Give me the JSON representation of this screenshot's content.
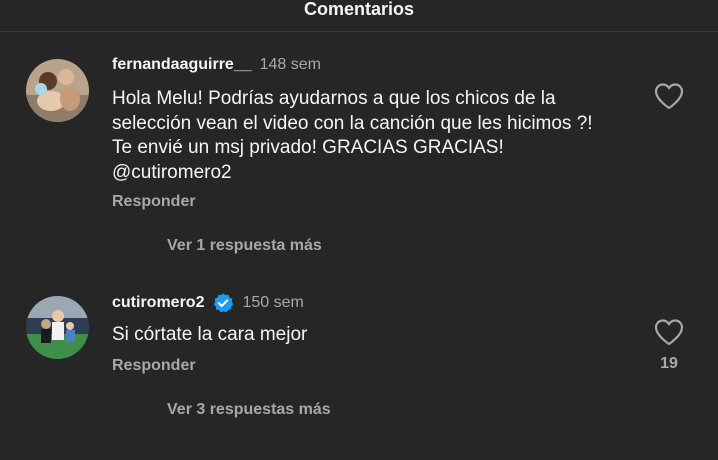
{
  "header": {
    "title": "Comentarios"
  },
  "comments": [
    {
      "username": "fernandaaguirre__",
      "time": "148 sem",
      "text_lines": [
        "Hola Melu! Podrías ayudarnos a que los chicos de la",
        "selección vean el video con la canción que les hicimos ?!",
        "Te envié un msj privado! GRACIAS GRACIAS!",
        "@cutiromero2"
      ],
      "reply_label": "Responder",
      "view_replies": "Ver 1 respuesta más",
      "icons": {
        "avatar": "avatar-image",
        "like": "heart-outline-icon"
      }
    },
    {
      "username": "cutiromero2",
      "time": "150 sem",
      "verified": true,
      "text_lines": [
        "Si córtate la cara mejor"
      ],
      "reply_label": "Responder",
      "view_replies": "Ver 3 respuestas más",
      "like_count": "19",
      "icons": {
        "avatar": "avatar-image",
        "like": "heart-outline-icon",
        "verified": "verified-badge-icon"
      }
    }
  ],
  "colors": {
    "background": "#262626",
    "primary_text": "#f5f5f5",
    "secondary_text": "#a8a8a8",
    "verified": "#1d9bf0"
  }
}
